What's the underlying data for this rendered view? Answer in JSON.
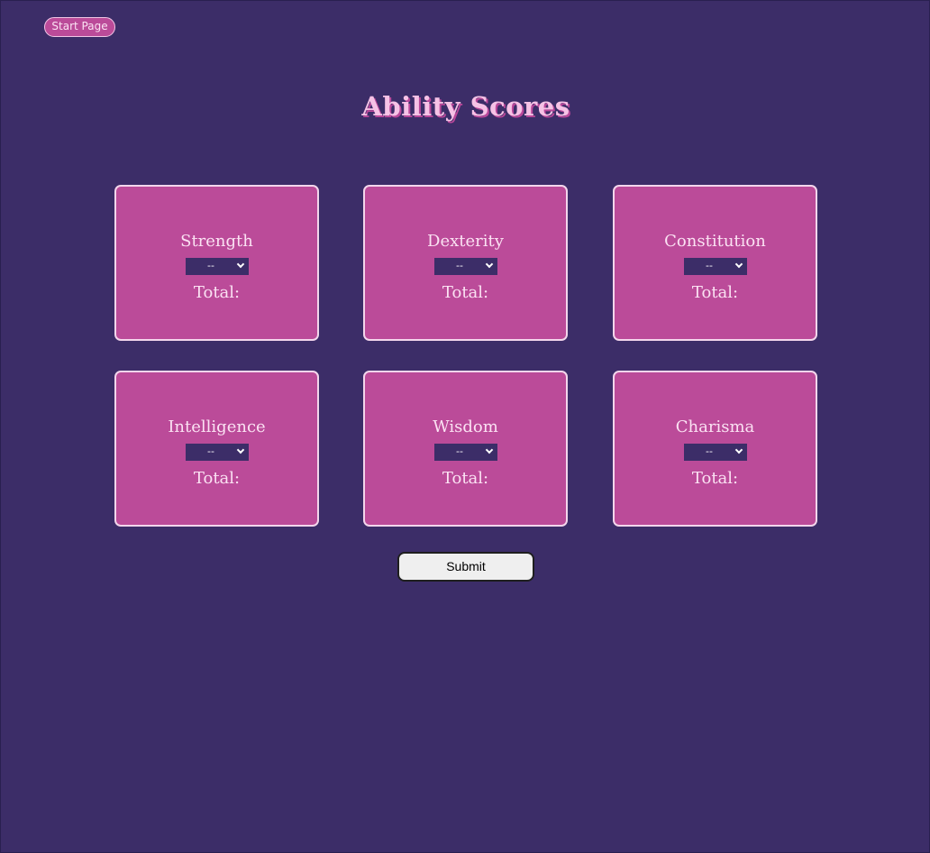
{
  "nav": {
    "start_page_label": "Start Page"
  },
  "page": {
    "title": "Ability Scores",
    "total_label": "Total:",
    "submit_label": "Submit"
  },
  "abilities": [
    {
      "name": "Strength",
      "selected": "--"
    },
    {
      "name": "Dexterity",
      "selected": "--"
    },
    {
      "name": "Constitution",
      "selected": "--"
    },
    {
      "name": "Intelligence",
      "selected": "--"
    },
    {
      "name": "Wisdom",
      "selected": "--"
    },
    {
      "name": "Charisma",
      "selected": "--"
    }
  ],
  "colors": {
    "background": "#3c2d68",
    "card": "#bb4b99",
    "card_border": "#f3d6ec",
    "text": "#fbe2f3",
    "title": "#f6c2e6"
  },
  "icons": {
    "select_arrow": "chevron-down-icon"
  }
}
